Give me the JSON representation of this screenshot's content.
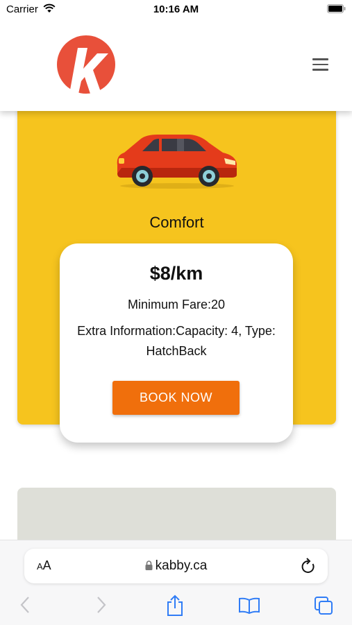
{
  "status_bar": {
    "carrier": "Carrier",
    "time": "10:16 AM"
  },
  "header": {
    "logo_icon": "kabby-logo-k",
    "menu_icon": "hamburger-icon"
  },
  "plan": {
    "name": "Comfort",
    "price": "$8/km",
    "minimum_fare": "Minimum Fare:20",
    "extra_information": "Extra Information:Capacity: 4, Type: HatchBack",
    "book_label": "BOOK NOW"
  },
  "browser": {
    "text_size_label_small": "A",
    "text_size_label_large": "A",
    "url": "kabby.ca"
  },
  "colors": {
    "card_background": "#f6c41e",
    "book_button": "#f06f0c",
    "logo_red": "#e8503a",
    "next_card": "#dedfd8",
    "ios_blue": "#2f7cf6"
  }
}
